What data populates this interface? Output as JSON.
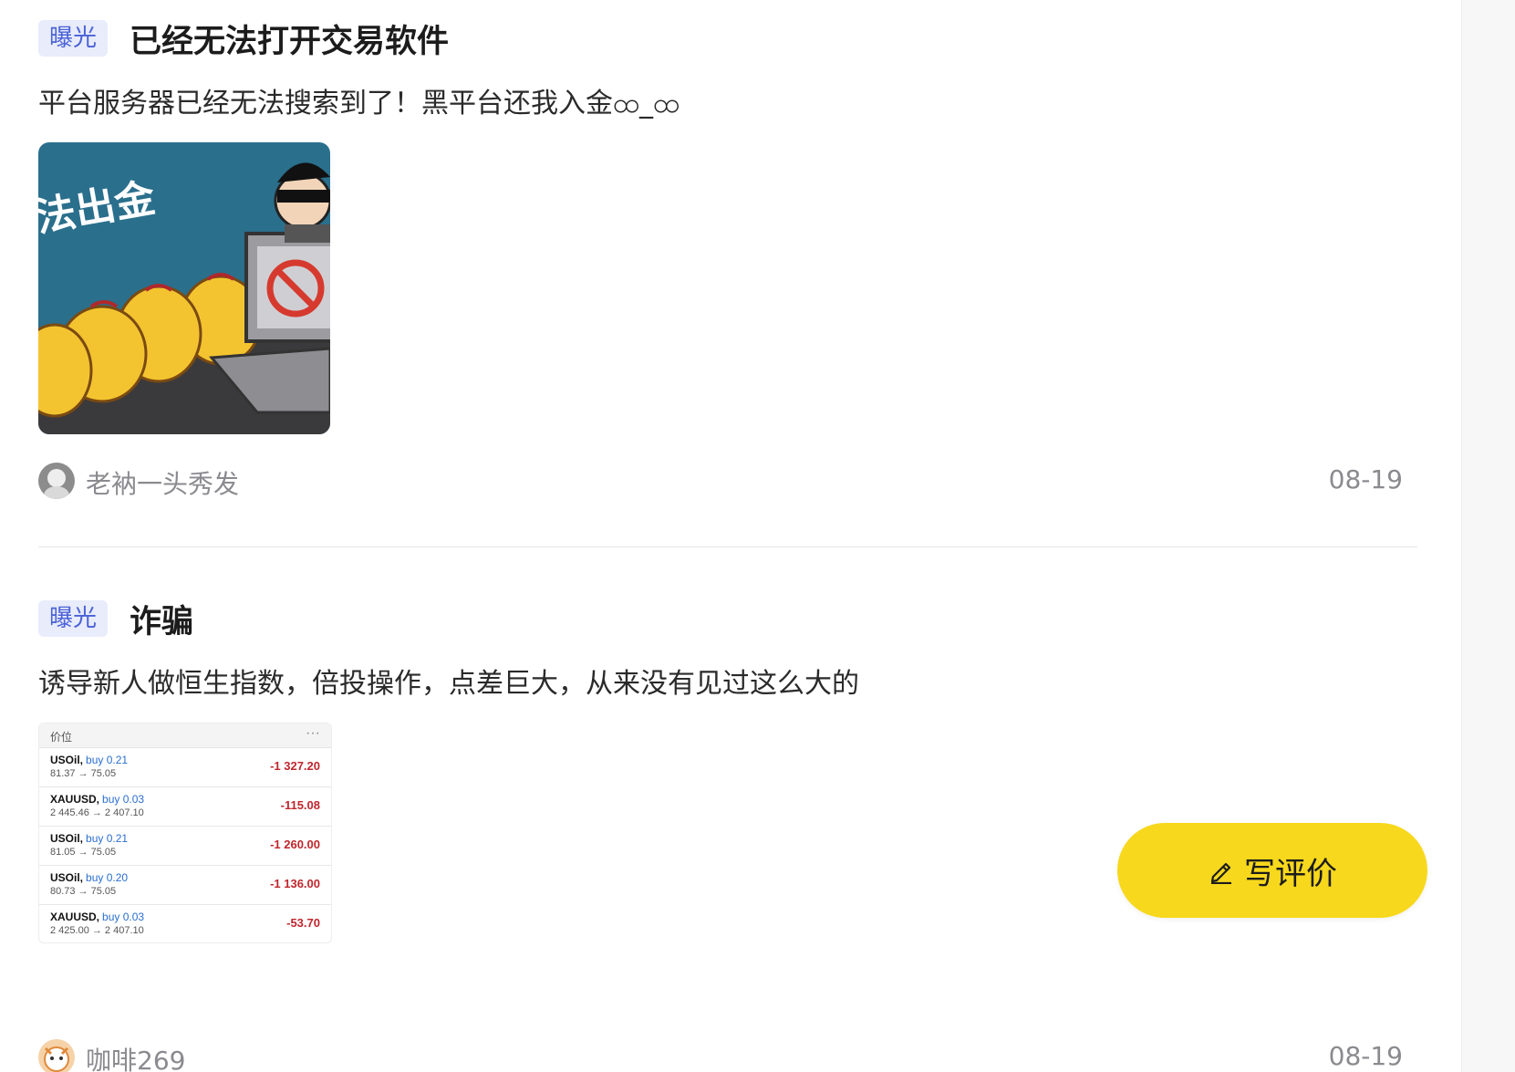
{
  "posts": [
    {
      "tag": "曝光",
      "title": "已经无法打开交易软件",
      "description": "平台服务器已经无法搜索到了！黑平台还我入金ထ_ထ",
      "image_text": "法出金",
      "author": "老衲一头秀发",
      "date": "08-19"
    },
    {
      "tag": "曝光",
      "title": "诈骗",
      "description": "诱导新人做恒生指数，倍投操作，点差巨大，从来没有见过这么大的",
      "author": "咖啡269",
      "date": "08-19",
      "trade_card": {
        "header": "价位",
        "more": "···",
        "rows": [
          {
            "symbol": "USOil,",
            "side": "buy 0.21",
            "prices": "81.37 → 75.05",
            "pl": "-1 327.20"
          },
          {
            "symbol": "XAUUSD,",
            "side": "buy 0.03",
            "prices": "2 445.46 → 2 407.10",
            "pl": "-115.08"
          },
          {
            "symbol": "USOil,",
            "side": "buy 0.21",
            "prices": "81.05 → 75.05",
            "pl": "-1 260.00"
          },
          {
            "symbol": "USOil,",
            "side": "buy 0.20",
            "prices": "80.73 → 75.05",
            "pl": "-1 136.00"
          },
          {
            "symbol": "XAUUSD,",
            "side": "buy 0.03",
            "prices": "2 425.00 → 2 407.10",
            "pl": "-53.70"
          }
        ]
      }
    }
  ],
  "write_review": {
    "label": "写评价",
    "icon": "pencil-icon"
  },
  "colors": {
    "tag_bg": "#e8ecfb",
    "tag_text": "#4b62d8",
    "button_yellow": "#f7d81c",
    "loss_red": "#c0262d",
    "buy_blue": "#2a6fcf"
  }
}
